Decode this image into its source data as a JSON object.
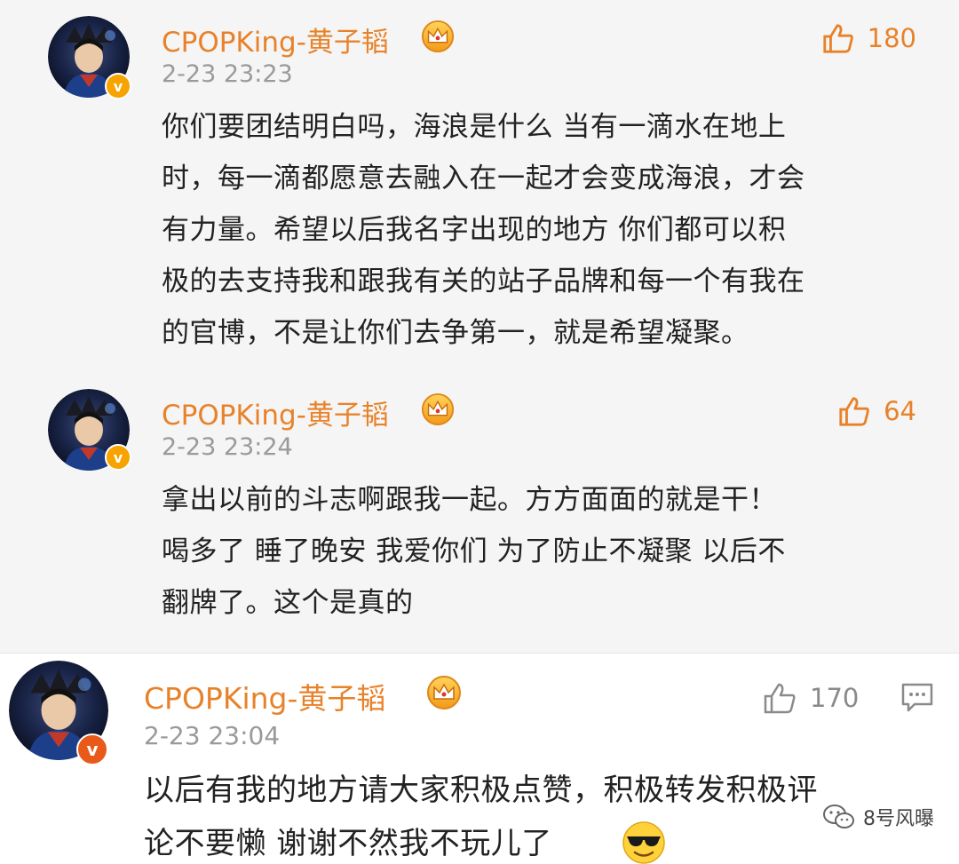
{
  "comments": [
    {
      "username": "CPOPKing-黄子韬",
      "timestamp": "2-23 23:23",
      "likes": "180",
      "lines": [
        "你们要团结明白吗，海浪是什么 当有一滴水在地上",
        "时，每一滴都愿意去融入在一起才会变成海浪，才会",
        "有力量。希望以后我名字出现的地方 你们都可以积",
        "极的去支持我和跟我有关的站子品牌和每一个有我在",
        "的官博，不是让你们去争第一，就是希望凝聚。"
      ]
    },
    {
      "username": "CPOPKing-黄子韬",
      "timestamp": "2-23 23:24",
      "likes": "64",
      "lines": [
        "拿出以前的斗志啊跟我一起。方方面面的就是干！",
        "喝多了 睡了晚安 我爱你们 为了防止不凝聚 以后不",
        "翻牌了。这个是真的"
      ]
    },
    {
      "username": "CPOPKing-黄子韬",
      "timestamp": "2-23 23:04",
      "likes": "170",
      "lines": [
        "以后有我的地方请大家积极点赞，积极转发积极评",
        "论不要懒 谢谢不然我不玩儿了"
      ]
    }
  ],
  "badge_letter": "v",
  "watermark": "8号风曝",
  "icons": {
    "like": "thumbs-up-icon",
    "reply": "comment-icon",
    "crown": "crown-icon",
    "emoji": "sunglasses-emoji-icon",
    "wechat": "wechat-icon"
  },
  "colors": {
    "username": "#e8822a",
    "timestamp": "#9a9a9a",
    "text": "#222222",
    "like_active": "#e8822a",
    "like_plain": "#8a8a8a",
    "badge": "#f7a300"
  }
}
